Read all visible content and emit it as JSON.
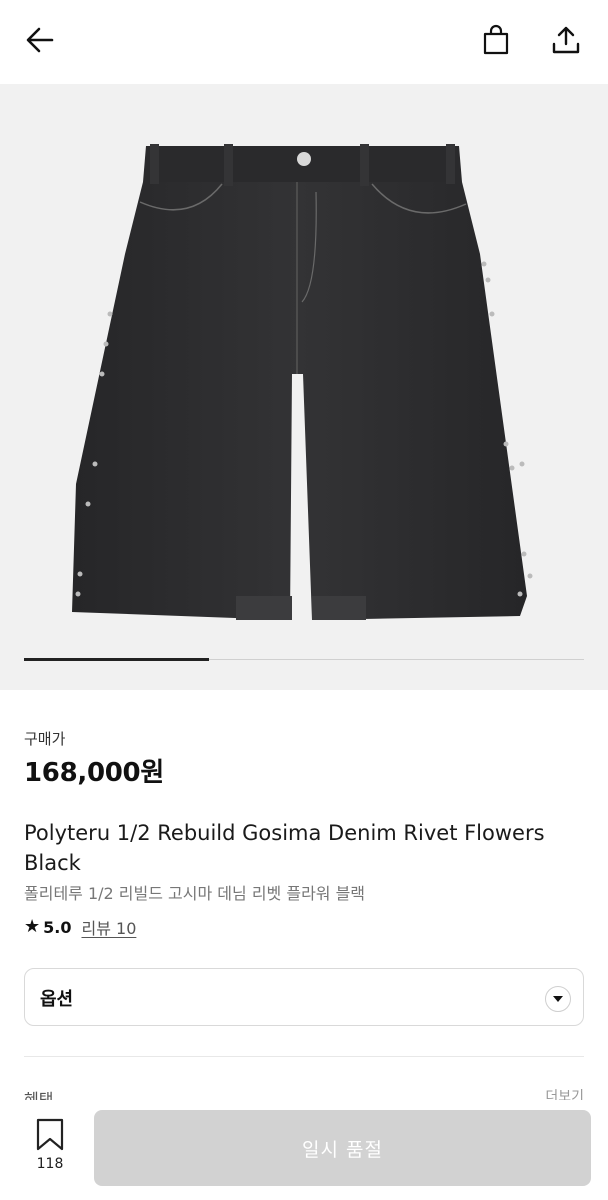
{
  "header": {
    "back_icon": "arrow-left-icon",
    "cart_icon": "shopping-bag-icon",
    "share_icon": "share-icon"
  },
  "gallery": {
    "image_subject": "black denim bermuda shorts with rivets",
    "slide_progress_fraction": 0.33
  },
  "price": {
    "label": "구매가",
    "value": "168,000원"
  },
  "product": {
    "title_en": "Polyteru 1/2 Rebuild Gosima Denim Rivet Flowers Black",
    "title_ko": "폴리테루 1/2 리빌드 고시마 데님 리벳 플라워 블랙"
  },
  "rating": {
    "star_icon": "star-icon",
    "score": "5.0",
    "review_link": "리뷰 10"
  },
  "option": {
    "label": "옵션",
    "icon": "chevron-down-icon"
  },
  "bottom": {
    "wishlist_icon": "bookmark-icon",
    "wishlist_count": "118",
    "cta_label": "일시 품절"
  },
  "colors": {
    "cta_disabled": "#d2d2d2",
    "image_bg": "#f1f1f1",
    "denim": "#2b2b2d"
  }
}
